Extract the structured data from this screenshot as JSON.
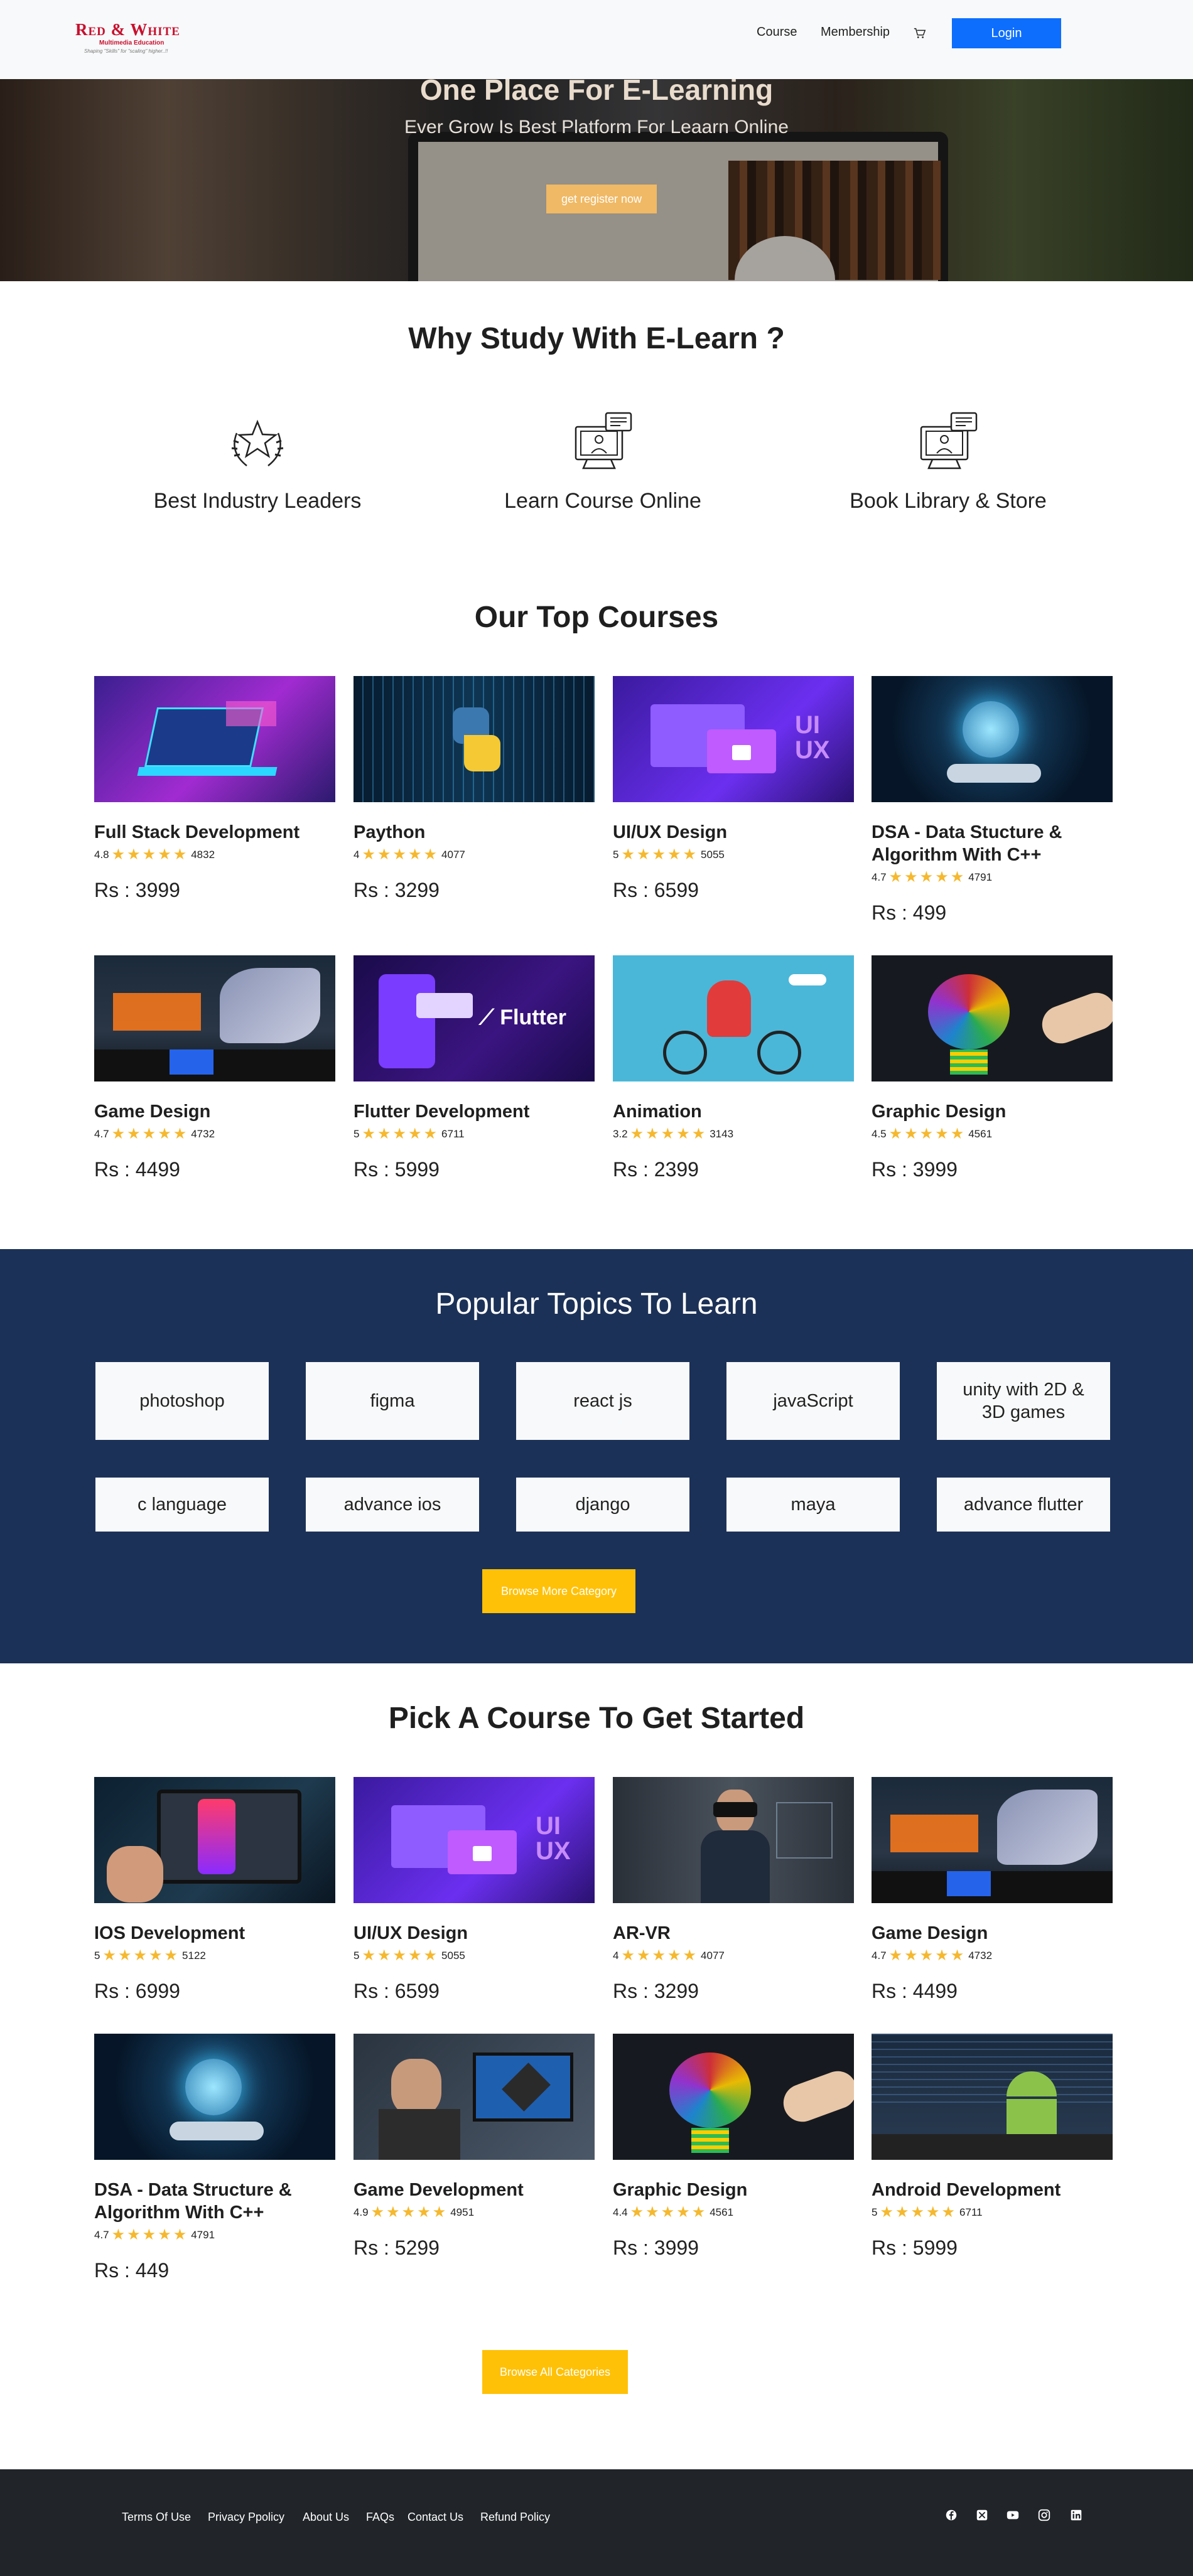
{
  "brand": {
    "name": "Red & White",
    "tagline": "Multimedia Education",
    "motto": "Shaping \"Skills\" for \"scaling\" higher..!!"
  },
  "nav": {
    "links": [
      "Course",
      "Membership"
    ],
    "login_label": "Login"
  },
  "hero": {
    "title": "One Place For E-Learning",
    "subtitle": "Ever Grow Is Best Platform For Leaarn Online",
    "cta_label": "get register now"
  },
  "why": {
    "title": "Why Study With E-Learn ?",
    "features": [
      {
        "label": "Best Industry Leaders",
        "icon": "laurel-star-icon"
      },
      {
        "label": "Learn Course Online",
        "icon": "online-course-icon"
      },
      {
        "label": "Book Library & Store",
        "icon": "online-course-icon"
      }
    ]
  },
  "top_courses": {
    "title": "Our Top Courses",
    "items": [
      {
        "name": "Full Stack Development",
        "rating": "4.8",
        "count": "4832",
        "price": "Rs : 3999",
        "thumb": "laptop-code"
      },
      {
        "name": "Paython",
        "rating": "4",
        "count": "4077",
        "price": "Rs : 3299",
        "thumb": "python"
      },
      {
        "name": "UI/UX Design",
        "rating": "5",
        "count": "5055",
        "price": "Rs : 6599",
        "thumb": "uiux"
      },
      {
        "name": "DSA - Data Stucture & Algorithm With C++",
        "rating": "4.7",
        "count": "4791",
        "price": "Rs : 499",
        "thumb": "globe-hand"
      },
      {
        "name": "Game Design",
        "rating": "4.7",
        "count": "4732",
        "price": "Rs : 4499",
        "thumb": "gaming-room"
      },
      {
        "name": "Flutter Development",
        "rating": "5",
        "count": "6711",
        "price": "Rs : 5999",
        "thumb": "flutter"
      },
      {
        "name": "Animation",
        "rating": "3.2",
        "count": "3143",
        "price": "Rs : 2399",
        "thumb": "bicycle"
      },
      {
        "name": "Graphic Design",
        "rating": "4.5",
        "count": "4561",
        "price": "Rs : 3999",
        "thumb": "bulb"
      }
    ]
  },
  "topics": {
    "title": "Popular Topics To Learn",
    "chips": [
      "photoshop",
      "figma",
      "react js",
      "javaScript",
      "unity with 2D & 3D games",
      "c language",
      "advance ios",
      "django",
      "maya",
      "advance flutter"
    ],
    "browse_label": "Browse More Category"
  },
  "pick": {
    "title": "Pick A Course To Get Started",
    "items": [
      {
        "name": "IOS Development",
        "rating": "5",
        "count": "5122",
        "price": "Rs : 6999",
        "thumb": "ios"
      },
      {
        "name": "UI/UX Design",
        "rating": "5",
        "count": "5055",
        "price": "Rs : 6599",
        "thumb": "uiux"
      },
      {
        "name": "AR-VR",
        "rating": "4",
        "count": "4077",
        "price": "Rs : 3299",
        "thumb": "vr"
      },
      {
        "name": "Game Design",
        "rating": "4.7",
        "count": "4732",
        "price": "Rs : 4499",
        "thumb": "gaming-room"
      },
      {
        "name": "DSA - Data Structure & Algorithm With C++",
        "rating": "4.7",
        "count": "4791",
        "price": "Rs : 449",
        "thumb": "globe-hand"
      },
      {
        "name": "Game Development",
        "rating": "4.9",
        "count": "4951",
        "price": "Rs : 5299",
        "thumb": "dev-office"
      },
      {
        "name": "Graphic Design",
        "rating": "4.4",
        "count": "4561",
        "price": "Rs : 3999",
        "thumb": "bulb"
      },
      {
        "name": "Android Development",
        "rating": "5",
        "count": "6711",
        "price": "Rs : 5999",
        "thumb": "android"
      }
    ],
    "browse_label": "Browse All Categories"
  },
  "stars": "★★★★★",
  "footer": {
    "links": [
      "Terms Of Use",
      "Privacy Ppolicy",
      "About Us",
      "FAQs",
      "Contact Us",
      "Refund Policy"
    ],
    "social": [
      "facebook-icon",
      "x-twitter-icon",
      "youtube-icon",
      "instagram-icon",
      "linkedin-icon"
    ]
  },
  "colors": {
    "primary": "#0d6efd",
    "accent": "#ffc107",
    "topics_bg": "#1c3157",
    "footer_bg": "#212529",
    "star": "#f5b82e",
    "brand_red": "#c8102e"
  }
}
